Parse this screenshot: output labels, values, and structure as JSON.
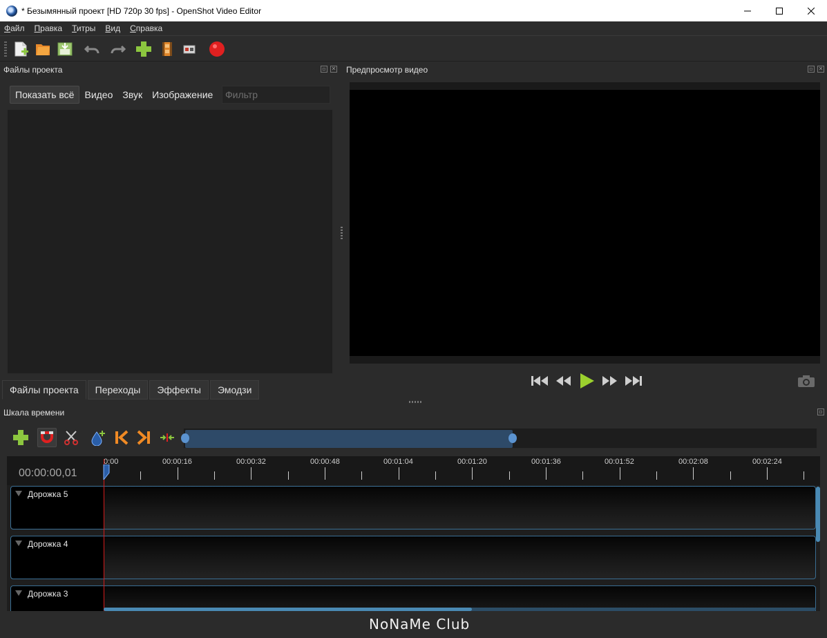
{
  "window": {
    "title": "* Безымянный проект [HD 720p 30 fps] - OpenShot Video Editor",
    "app_icon": "openshot-logo-icon"
  },
  "menu": [
    "Файл",
    "Правка",
    "Титры",
    "Вид",
    "Справка"
  ],
  "toolbar": {
    "icons": [
      "new-project-icon",
      "open-project-icon",
      "save-project-icon",
      "undo-icon",
      "redo-icon",
      "import-files-icon",
      "choose-profile-icon",
      "fullscreen-icon",
      "export-video-icon"
    ]
  },
  "project_files": {
    "title": "Файлы проекта",
    "filters": [
      "Показать всё",
      "Видео",
      "Звук",
      "Изображение"
    ],
    "filter_placeholder": "Фильтр"
  },
  "bottom_tabs": [
    "Файлы проекта",
    "Переходы",
    "Эффекты",
    "Эмодзи"
  ],
  "preview": {
    "title": "Предпросмотр видео"
  },
  "timeline": {
    "title": "Шкала времени",
    "current_time": "00:00:00,01",
    "ruler_labels": [
      "0:00",
      "00:00:16",
      "00:00:32",
      "00:00:48",
      "00:01:04",
      "00:01:20",
      "00:01:36",
      "00:01:52",
      "00:02:08",
      "00:02:24"
    ],
    "tracks": [
      "Дорожка 5",
      "Дорожка 4",
      "Дорожка 3"
    ]
  },
  "watermark": "NoNaMe Club",
  "colors": {
    "accent": "#4a8ab4",
    "playhead": "#d51c1c",
    "record": "#e02020",
    "add_green": "#8cc63f"
  }
}
